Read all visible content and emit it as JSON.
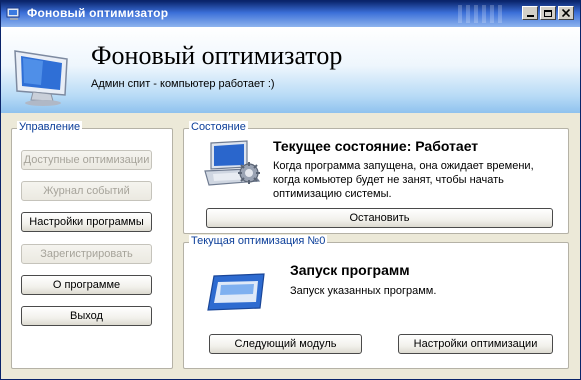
{
  "window": {
    "title": "Фоновый оптимизатор"
  },
  "header": {
    "title": "Фоновый оптимизатор",
    "subtitle": "Админ спит - компьютер работает :)"
  },
  "manage": {
    "legend": "Управление",
    "buttons": [
      {
        "label": "Доступные оптимизации",
        "enabled": false
      },
      {
        "label": "Журнал событий",
        "enabled": false
      },
      {
        "label": "Настройки программы",
        "enabled": true
      },
      {
        "label": "Зарегистрировать",
        "enabled": false
      },
      {
        "label": "О программе",
        "enabled": true
      },
      {
        "label": "Выход",
        "enabled": true
      }
    ]
  },
  "state": {
    "legend": "Состояние",
    "title": "Текущее состояние:  Работает",
    "description_lines": [
      "Когда программа запущена, она ожидает времени,",
      "когда комьютер будет не занят, чтобы начать",
      "оптимизацию системы."
    ],
    "stop_button": "Остановить"
  },
  "current": {
    "legend": "Текущая оптимизация №0",
    "title": "Запуск программ",
    "description": "Запуск указанных программ.",
    "next_button": "Следующий модуль",
    "settings_button": "Настройки оптимизации"
  },
  "colors": {
    "titlebar_start": "#0a246a",
    "titlebar_end": "#8fb4ee",
    "legend_text": "#0b3e99",
    "header_bottom": "#8fc2ee"
  },
  "icons": [
    "app-icon",
    "minimize-icon",
    "maximize-icon",
    "close-icon",
    "monitor-icon",
    "laptop-gear-icon",
    "window-module-icon"
  ]
}
